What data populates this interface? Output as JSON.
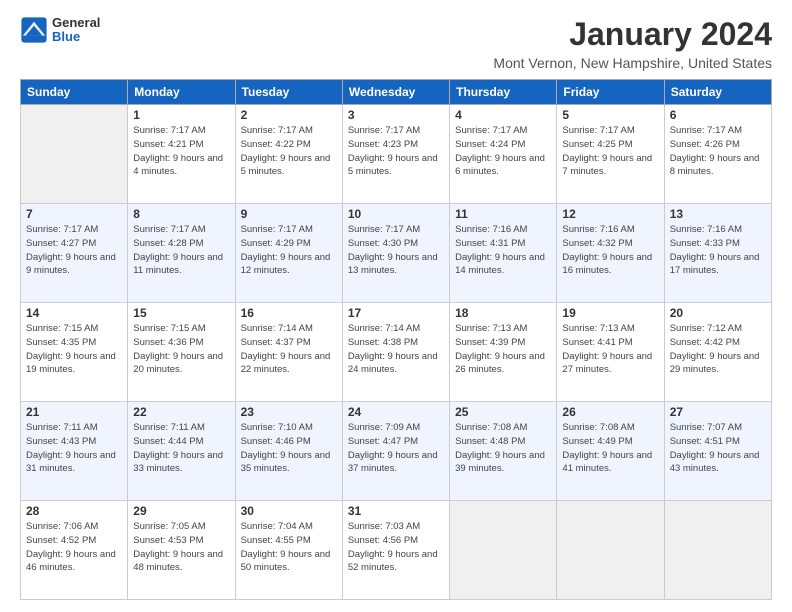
{
  "logo": {
    "line1": "General",
    "line2": "Blue"
  },
  "title": "January 2024",
  "subtitle": "Mont Vernon, New Hampshire, United States",
  "days_header": [
    "Sunday",
    "Monday",
    "Tuesday",
    "Wednesday",
    "Thursday",
    "Friday",
    "Saturday"
  ],
  "weeks": [
    [
      {
        "num": "",
        "empty": true
      },
      {
        "num": "1",
        "sunrise": "7:17 AM",
        "sunset": "4:21 PM",
        "daylight": "9 hours and 4 minutes."
      },
      {
        "num": "2",
        "sunrise": "7:17 AM",
        "sunset": "4:22 PM",
        "daylight": "9 hours and 5 minutes."
      },
      {
        "num": "3",
        "sunrise": "7:17 AM",
        "sunset": "4:23 PM",
        "daylight": "9 hours and 5 minutes."
      },
      {
        "num": "4",
        "sunrise": "7:17 AM",
        "sunset": "4:24 PM",
        "daylight": "9 hours and 6 minutes."
      },
      {
        "num": "5",
        "sunrise": "7:17 AM",
        "sunset": "4:25 PM",
        "daylight": "9 hours and 7 minutes."
      },
      {
        "num": "6",
        "sunrise": "7:17 AM",
        "sunset": "4:26 PM",
        "daylight": "9 hours and 8 minutes."
      }
    ],
    [
      {
        "num": "7",
        "sunrise": "7:17 AM",
        "sunset": "4:27 PM",
        "daylight": "9 hours and 9 minutes."
      },
      {
        "num": "8",
        "sunrise": "7:17 AM",
        "sunset": "4:28 PM",
        "daylight": "9 hours and 11 minutes."
      },
      {
        "num": "9",
        "sunrise": "7:17 AM",
        "sunset": "4:29 PM",
        "daylight": "9 hours and 12 minutes."
      },
      {
        "num": "10",
        "sunrise": "7:17 AM",
        "sunset": "4:30 PM",
        "daylight": "9 hours and 13 minutes."
      },
      {
        "num": "11",
        "sunrise": "7:16 AM",
        "sunset": "4:31 PM",
        "daylight": "9 hours and 14 minutes."
      },
      {
        "num": "12",
        "sunrise": "7:16 AM",
        "sunset": "4:32 PM",
        "daylight": "9 hours and 16 minutes."
      },
      {
        "num": "13",
        "sunrise": "7:16 AM",
        "sunset": "4:33 PM",
        "daylight": "9 hours and 17 minutes."
      }
    ],
    [
      {
        "num": "14",
        "sunrise": "7:15 AM",
        "sunset": "4:35 PM",
        "daylight": "9 hours and 19 minutes."
      },
      {
        "num": "15",
        "sunrise": "7:15 AM",
        "sunset": "4:36 PM",
        "daylight": "9 hours and 20 minutes."
      },
      {
        "num": "16",
        "sunrise": "7:14 AM",
        "sunset": "4:37 PM",
        "daylight": "9 hours and 22 minutes."
      },
      {
        "num": "17",
        "sunrise": "7:14 AM",
        "sunset": "4:38 PM",
        "daylight": "9 hours and 24 minutes."
      },
      {
        "num": "18",
        "sunrise": "7:13 AM",
        "sunset": "4:39 PM",
        "daylight": "9 hours and 26 minutes."
      },
      {
        "num": "19",
        "sunrise": "7:13 AM",
        "sunset": "4:41 PM",
        "daylight": "9 hours and 27 minutes."
      },
      {
        "num": "20",
        "sunrise": "7:12 AM",
        "sunset": "4:42 PM",
        "daylight": "9 hours and 29 minutes."
      }
    ],
    [
      {
        "num": "21",
        "sunrise": "7:11 AM",
        "sunset": "4:43 PM",
        "daylight": "9 hours and 31 minutes."
      },
      {
        "num": "22",
        "sunrise": "7:11 AM",
        "sunset": "4:44 PM",
        "daylight": "9 hours and 33 minutes."
      },
      {
        "num": "23",
        "sunrise": "7:10 AM",
        "sunset": "4:46 PM",
        "daylight": "9 hours and 35 minutes."
      },
      {
        "num": "24",
        "sunrise": "7:09 AM",
        "sunset": "4:47 PM",
        "daylight": "9 hours and 37 minutes."
      },
      {
        "num": "25",
        "sunrise": "7:08 AM",
        "sunset": "4:48 PM",
        "daylight": "9 hours and 39 minutes."
      },
      {
        "num": "26",
        "sunrise": "7:08 AM",
        "sunset": "4:49 PM",
        "daylight": "9 hours and 41 minutes."
      },
      {
        "num": "27",
        "sunrise": "7:07 AM",
        "sunset": "4:51 PM",
        "daylight": "9 hours and 43 minutes."
      }
    ],
    [
      {
        "num": "28",
        "sunrise": "7:06 AM",
        "sunset": "4:52 PM",
        "daylight": "9 hours and 46 minutes."
      },
      {
        "num": "29",
        "sunrise": "7:05 AM",
        "sunset": "4:53 PM",
        "daylight": "9 hours and 48 minutes."
      },
      {
        "num": "30",
        "sunrise": "7:04 AM",
        "sunset": "4:55 PM",
        "daylight": "9 hours and 50 minutes."
      },
      {
        "num": "31",
        "sunrise": "7:03 AM",
        "sunset": "4:56 PM",
        "daylight": "9 hours and 52 minutes."
      },
      {
        "num": "",
        "empty": true
      },
      {
        "num": "",
        "empty": true
      },
      {
        "num": "",
        "empty": true
      }
    ]
  ],
  "labels": {
    "sunrise": "Sunrise:",
    "sunset": "Sunset:",
    "daylight": "Daylight:"
  }
}
